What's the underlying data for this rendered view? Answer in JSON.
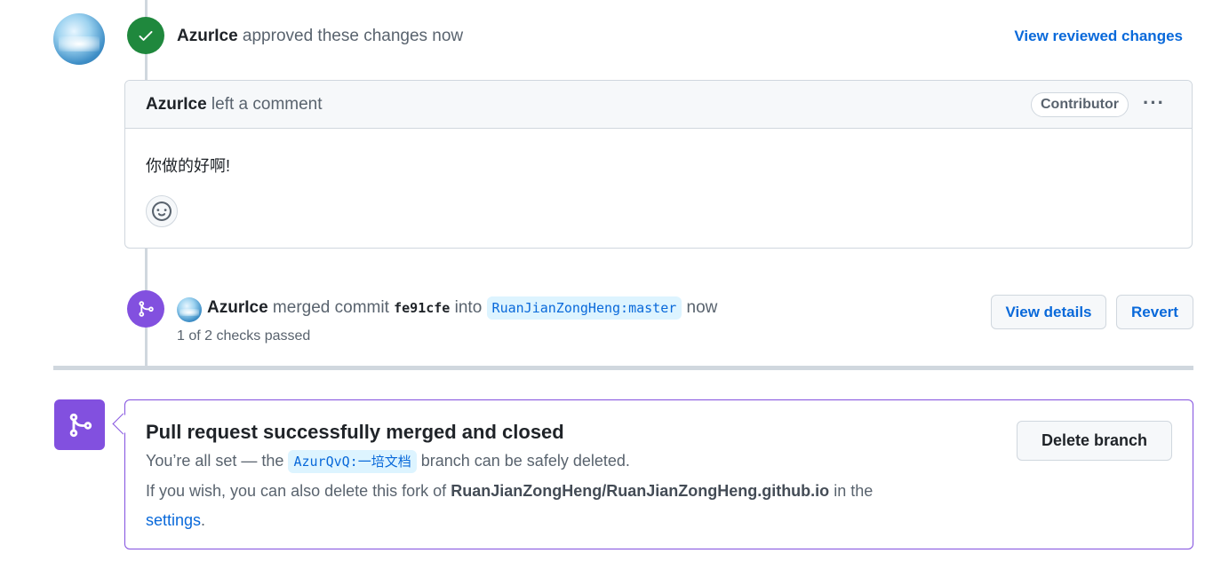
{
  "review": {
    "user": "AzurIce",
    "action": "approved these changes now",
    "view_reviewed_label": "View reviewed changes"
  },
  "comment": {
    "user": "AzurIce",
    "action": "left a comment",
    "role_badge": "Contributor",
    "more_label": "···",
    "body": "你做的好啊!"
  },
  "merge": {
    "user": "AzurIce",
    "action": "merged commit",
    "commit": "fe91cfe",
    "into": "into",
    "branch": "RuanJianZongHeng:master",
    "time": "now",
    "checks": "1 of 2 checks passed",
    "view_details_label": "View details",
    "revert_label": "Revert"
  },
  "merged_box": {
    "title": "Pull request successfully merged and closed",
    "line1_prefix": "You’re all set — the",
    "branch": "AzurQvQ:一培文档",
    "line1_suffix": "branch can be safely deleted.",
    "line2_prefix": "If you wish, you can also delete this fork of",
    "repo": "RuanJianZongHeng/RuanJianZongHeng.github.io",
    "line2_suffix": "in the",
    "settings_link": "settings",
    "period": ".",
    "delete_branch_label": "Delete branch"
  },
  "colors": {
    "approve_green": "#1f883d",
    "merge_purple": "#8250df",
    "link_blue": "#0969da"
  }
}
